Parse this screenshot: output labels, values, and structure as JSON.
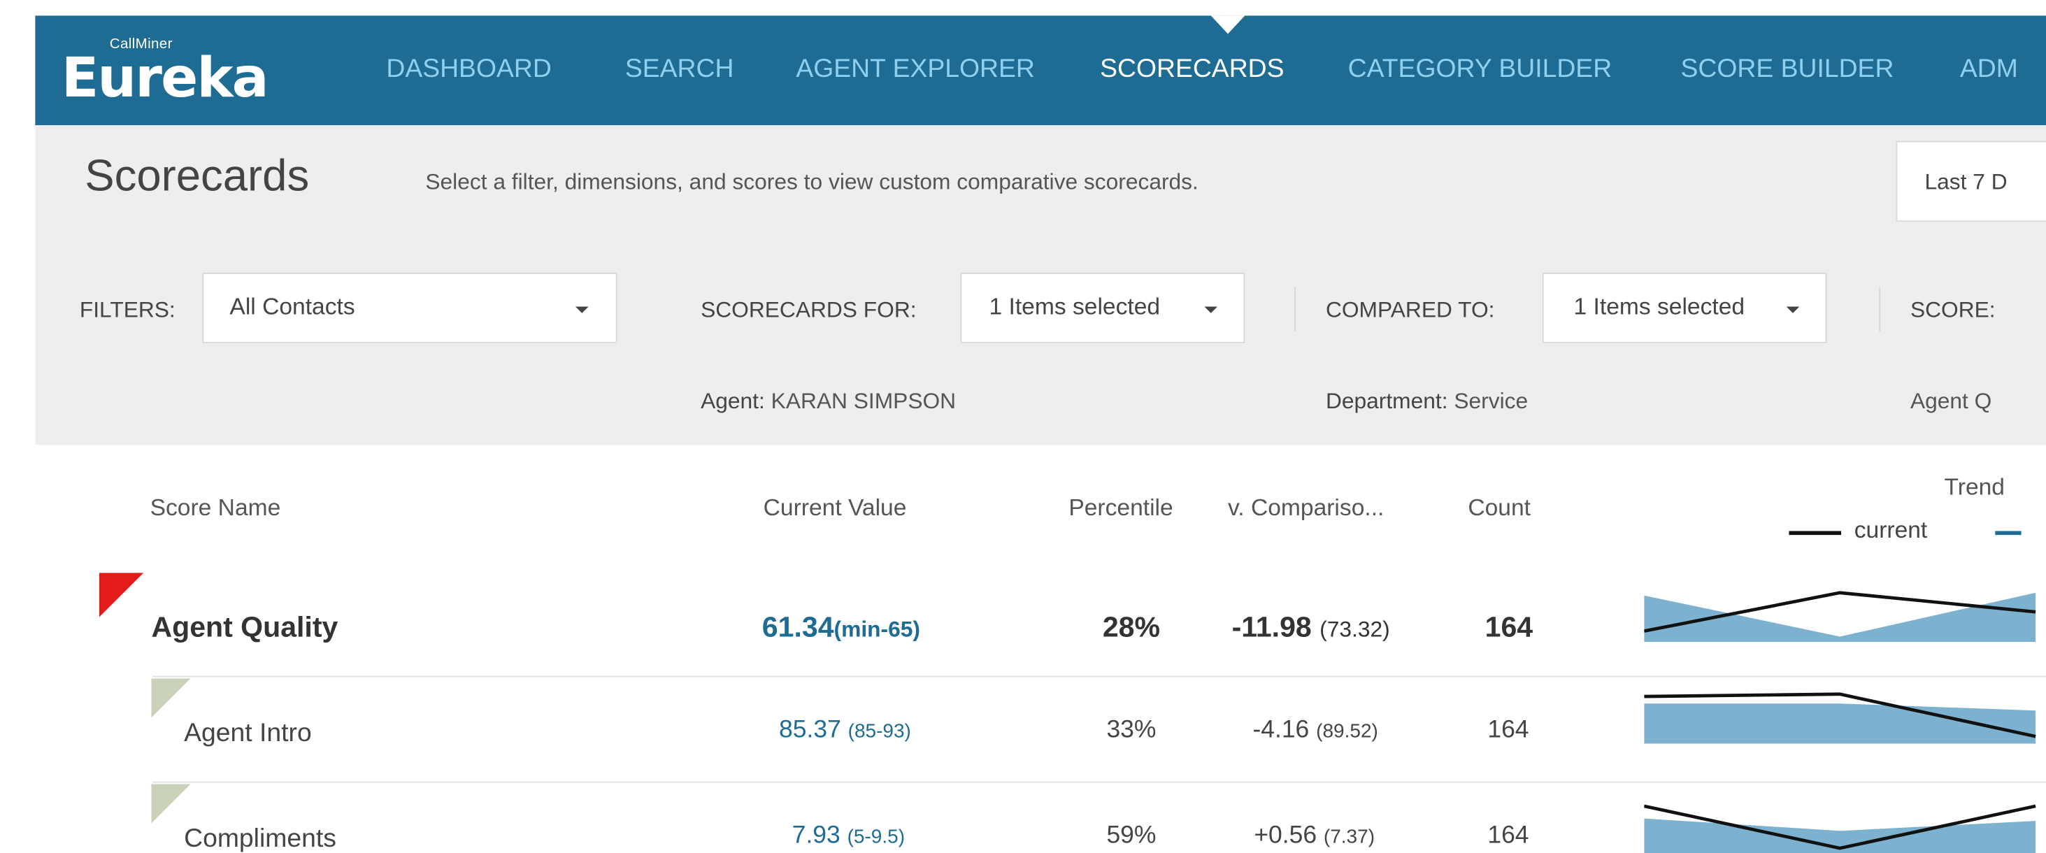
{
  "app": {
    "brand_small": "CallMiner",
    "brand_name": "Eureka"
  },
  "nav": {
    "items": [
      {
        "label": "DASHBOARD",
        "active": false
      },
      {
        "label": "SEARCH",
        "active": false
      },
      {
        "label": "AGENT EXPLORER",
        "active": false
      },
      {
        "label": "SCORECARDS",
        "active": true
      },
      {
        "label": "CATEGORY BUILDER",
        "active": false
      },
      {
        "label": "SCORE BUILDER",
        "active": false
      },
      {
        "label": "ADM",
        "active": false
      }
    ]
  },
  "page": {
    "title": "Scorecards",
    "subtitle": "Select a filter, dimensions, and scores to view custom comparative scorecards.",
    "date_range": "Last 7 D"
  },
  "filters": {
    "filters_label": "FILTERS:",
    "filter_value": "All Contacts",
    "scorecards_for_label": "SCORECARDS FOR:",
    "scorecards_for_value": "1 Items selected",
    "compared_to_label": "COMPARED TO:",
    "compared_to_value": "1 Items selected",
    "score_label": "SCORE:",
    "agent_key": "Agent:",
    "agent_value": "KARAN SIMPSON",
    "department_key": "Department:",
    "department_value": "Service",
    "score_selection": "Agent Q"
  },
  "table": {
    "headers": {
      "score_name": "Score Name",
      "current_value": "Current Value",
      "percentile": "Percentile",
      "comparison": "v. Compariso...",
      "count": "Count",
      "trend": "Trend"
    },
    "legend": {
      "current": "current"
    },
    "rows": [
      {
        "name": "Agent Quality",
        "value": "61.34",
        "range": "(min-65)",
        "percentile": "28%",
        "comparison": "-11.98",
        "comparison_value": "(73.32)",
        "count": "164",
        "flag_color": "#e31b1b",
        "trend_current": [
          0.85,
          0.15,
          0.5
        ],
        "trend_comparison": [
          0.2,
          0.95,
          0.15
        ]
      },
      {
        "name": "Agent Intro",
        "value": "85.37",
        "range": "(85-93)",
        "percentile": "33%",
        "comparison": "-4.16",
        "comparison_value": "(89.52)",
        "count": "164",
        "flag_color": "#c9d1b8",
        "trend_current": [
          0.05,
          0.0,
          0.9
        ],
        "trend_comparison": [
          0.2,
          0.2,
          0.35
        ]
      },
      {
        "name": "Compliments",
        "value": "7.93",
        "range": "(5-9.5)",
        "percentile": "59%",
        "comparison": "+0.56",
        "comparison_value": "(7.37)",
        "count": "164",
        "flag_color": "#c9d1b8",
        "trend_current": [
          0.1,
          0.95,
          0.1
        ],
        "trend_comparison": [
          0.35,
          0.6,
          0.4
        ]
      }
    ]
  },
  "colors": {
    "header_bg": "#1e6b93",
    "nav_inactive": "#8fd0ef",
    "panel_bg": "#eeeeee",
    "trend_fill": "#5b9fc4",
    "accent_value": "#1e6b93"
  }
}
